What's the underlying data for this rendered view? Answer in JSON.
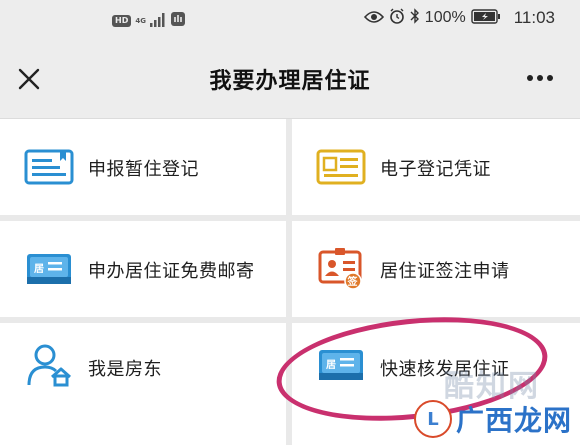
{
  "status_bar": {
    "hd": "HD",
    "network": "4G",
    "battery": "100%",
    "time": "11:03"
  },
  "header": {
    "title": "我要办理居住证",
    "close_icon": "close-icon",
    "more_icon": "more-icon"
  },
  "tiles": [
    {
      "label": "申报暂住登记",
      "icon": "id-card-icon",
      "color": "#2a8fd2"
    },
    {
      "label": "电子登记凭证",
      "icon": "certificate-icon",
      "color": "#e0b020"
    },
    {
      "label": "申办居住证免费邮寄",
      "icon": "residence-card-icon",
      "color": "#2a8fd2"
    },
    {
      "label": "居住证签注申请",
      "icon": "endorsement-icon",
      "color": "#d9562a"
    },
    {
      "label": "我是房东",
      "icon": "landlord-icon",
      "color": "#2a8fd2"
    },
    {
      "label": "快速核发居住证",
      "icon": "residence-card-icon",
      "color": "#2a8fd2"
    }
  ],
  "icon_text": {
    "card_char": "居",
    "sign_char": "签"
  },
  "annotation_color": "#c9306e",
  "watermark": {
    "text": "广西龙网",
    "faded_text": "酷知网"
  }
}
